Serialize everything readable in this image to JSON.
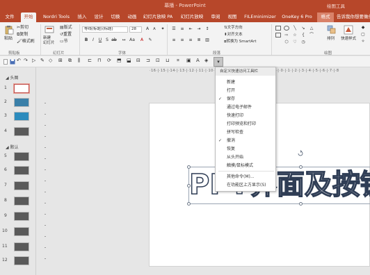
{
  "window": {
    "title": "幕播 - PowerPoint",
    "right_title": "绘图工具"
  },
  "tabs": [
    {
      "label": "文件"
    },
    {
      "label": "开始"
    },
    {
      "label": "Nordri Tools"
    },
    {
      "label": "插入"
    },
    {
      "label": "设计"
    },
    {
      "label": "切换"
    },
    {
      "label": "动画"
    },
    {
      "label": "幻灯片放映 PA"
    },
    {
      "label": "幻灯片放映"
    },
    {
      "label": "审阅"
    },
    {
      "label": "视图"
    },
    {
      "label": "FILEminimizer"
    },
    {
      "label": "OneKey 6 Pro"
    },
    {
      "label": "格式"
    },
    {
      "label": "告诉我你想要做什么"
    }
  ],
  "ribbon": {
    "clipboard": {
      "paste": "粘贴",
      "cut": "剪切",
      "copy": "复制",
      "format_painter": "格式刷",
      "label": "剪贴板"
    },
    "slides": {
      "new_slide": "新建\n幻灯片",
      "layout": "版式",
      "reset": "重置",
      "section": "节",
      "label": "幻灯片"
    },
    "font": {
      "font_name": "等线(标题)(标题)",
      "font_size": "28",
      "label": "字体"
    },
    "paragraph": {
      "text_direction": "文字方向",
      "align_text": "对齐文本",
      "smartart": "转换为 SmartArt",
      "label": "段落"
    },
    "drawing": {
      "arrange": "排列",
      "quick_styles": "快速样式",
      "label": "绘图"
    }
  },
  "slides_panel": {
    "section1": "头图",
    "section2": "默认",
    "thumbs": [
      "1",
      "2",
      "3",
      "4",
      "5",
      "6",
      "7",
      "8",
      "9",
      "10",
      "11",
      "12"
    ]
  },
  "ruler": {
    "marks": "·16·|·15·|·14·|·13·|·12·|·11·|·10·|·9·|·8·|·7·|·6·|·5·|·4·|·3·|·2·|·1·|·0·|·1·|·2·|·3·|·4·|·5·|·6·|·7·|·8"
  },
  "slide": {
    "big_text": "PPT界面及按钮功"
  },
  "qat_menu": {
    "header": "自定义快速访问工具栏",
    "items": [
      {
        "label": "新建",
        "checked": false
      },
      {
        "label": "打开",
        "checked": false
      },
      {
        "label": "保存",
        "checked": true
      },
      {
        "label": "通过电子邮件",
        "checked": false
      },
      {
        "label": "快速打印",
        "checked": false
      },
      {
        "label": "打印预览和打印",
        "checked": false
      },
      {
        "label": "拼写检查",
        "checked": false
      },
      {
        "label": "撤消",
        "checked": true
      },
      {
        "label": "恢复",
        "checked": false
      },
      {
        "label": "从头开始",
        "checked": false
      },
      {
        "label": "触摸/鼠标模式",
        "checked": false
      },
      {
        "label": "其他命令(M)...",
        "checked": false
      },
      {
        "label": "在功能区上方显示(S)",
        "checked": false
      }
    ]
  },
  "colors": {
    "accent": "#b7472a",
    "ribbon_bg": "#f3f3f3",
    "text_outline": "#2f3d55"
  }
}
